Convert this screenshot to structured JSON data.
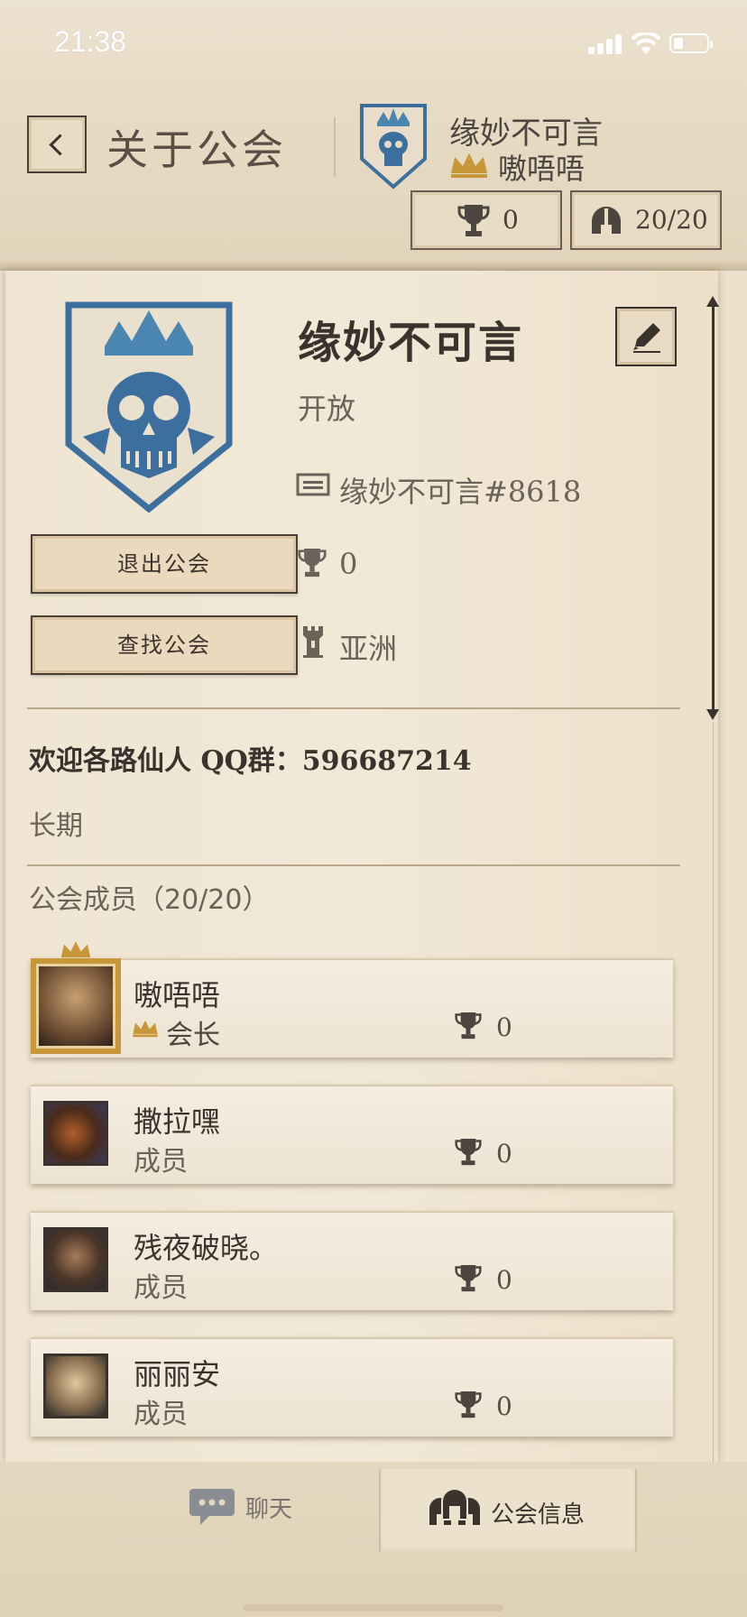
{
  "status_bar": {
    "time": "21:38"
  },
  "header": {
    "title": "关于公会",
    "guild_name": "缘妙不可言",
    "leader_name": "嗷唔唔",
    "trophies": "0",
    "members": "20/20"
  },
  "guild": {
    "name": "缘妙不可言",
    "status": "开放",
    "tag": "缘妙不可言#8618",
    "trophies": "0",
    "region": "亚洲",
    "description": "欢迎各路仙人 QQ群：596687214",
    "notice": "长期",
    "members_title": "公会成员（20/20）"
  },
  "buttons": {
    "leave": "退出公会",
    "find": "查找公会"
  },
  "members": [
    {
      "name": "嗷唔唔",
      "role": "会长",
      "trophies": "0"
    },
    {
      "name": "撒拉嘿",
      "role": "成员",
      "trophies": "0"
    },
    {
      "name": "残夜破晓。",
      "role": "成员",
      "trophies": "0"
    },
    {
      "name": "丽丽安",
      "role": "成员",
      "trophies": "0"
    }
  ],
  "tabs": [
    {
      "label": "聊天"
    },
    {
      "label": "公会信息"
    }
  ],
  "colors": {
    "emblem_blue": "#3d6f9e",
    "gold": "#c8973a",
    "ink": "#3a322c"
  }
}
